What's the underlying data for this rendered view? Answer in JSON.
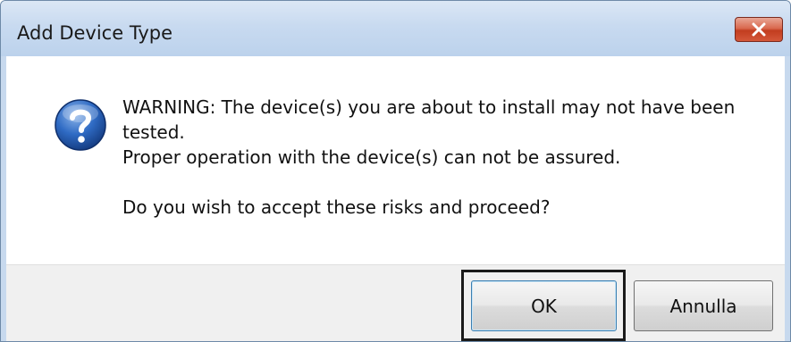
{
  "window": {
    "title": "Add Device Type",
    "close_icon": "close-icon",
    "close_color": "#c8442a"
  },
  "message": {
    "icon": "question-icon",
    "lines": [
      "WARNING: The device(s) you are about to install may not have been",
      "tested.",
      "Proper operation with the device(s) can not be assured.",
      "Do you wish to accept these risks and proceed?"
    ]
  },
  "buttons": {
    "ok_label": "OK",
    "cancel_label": "Annulla"
  }
}
